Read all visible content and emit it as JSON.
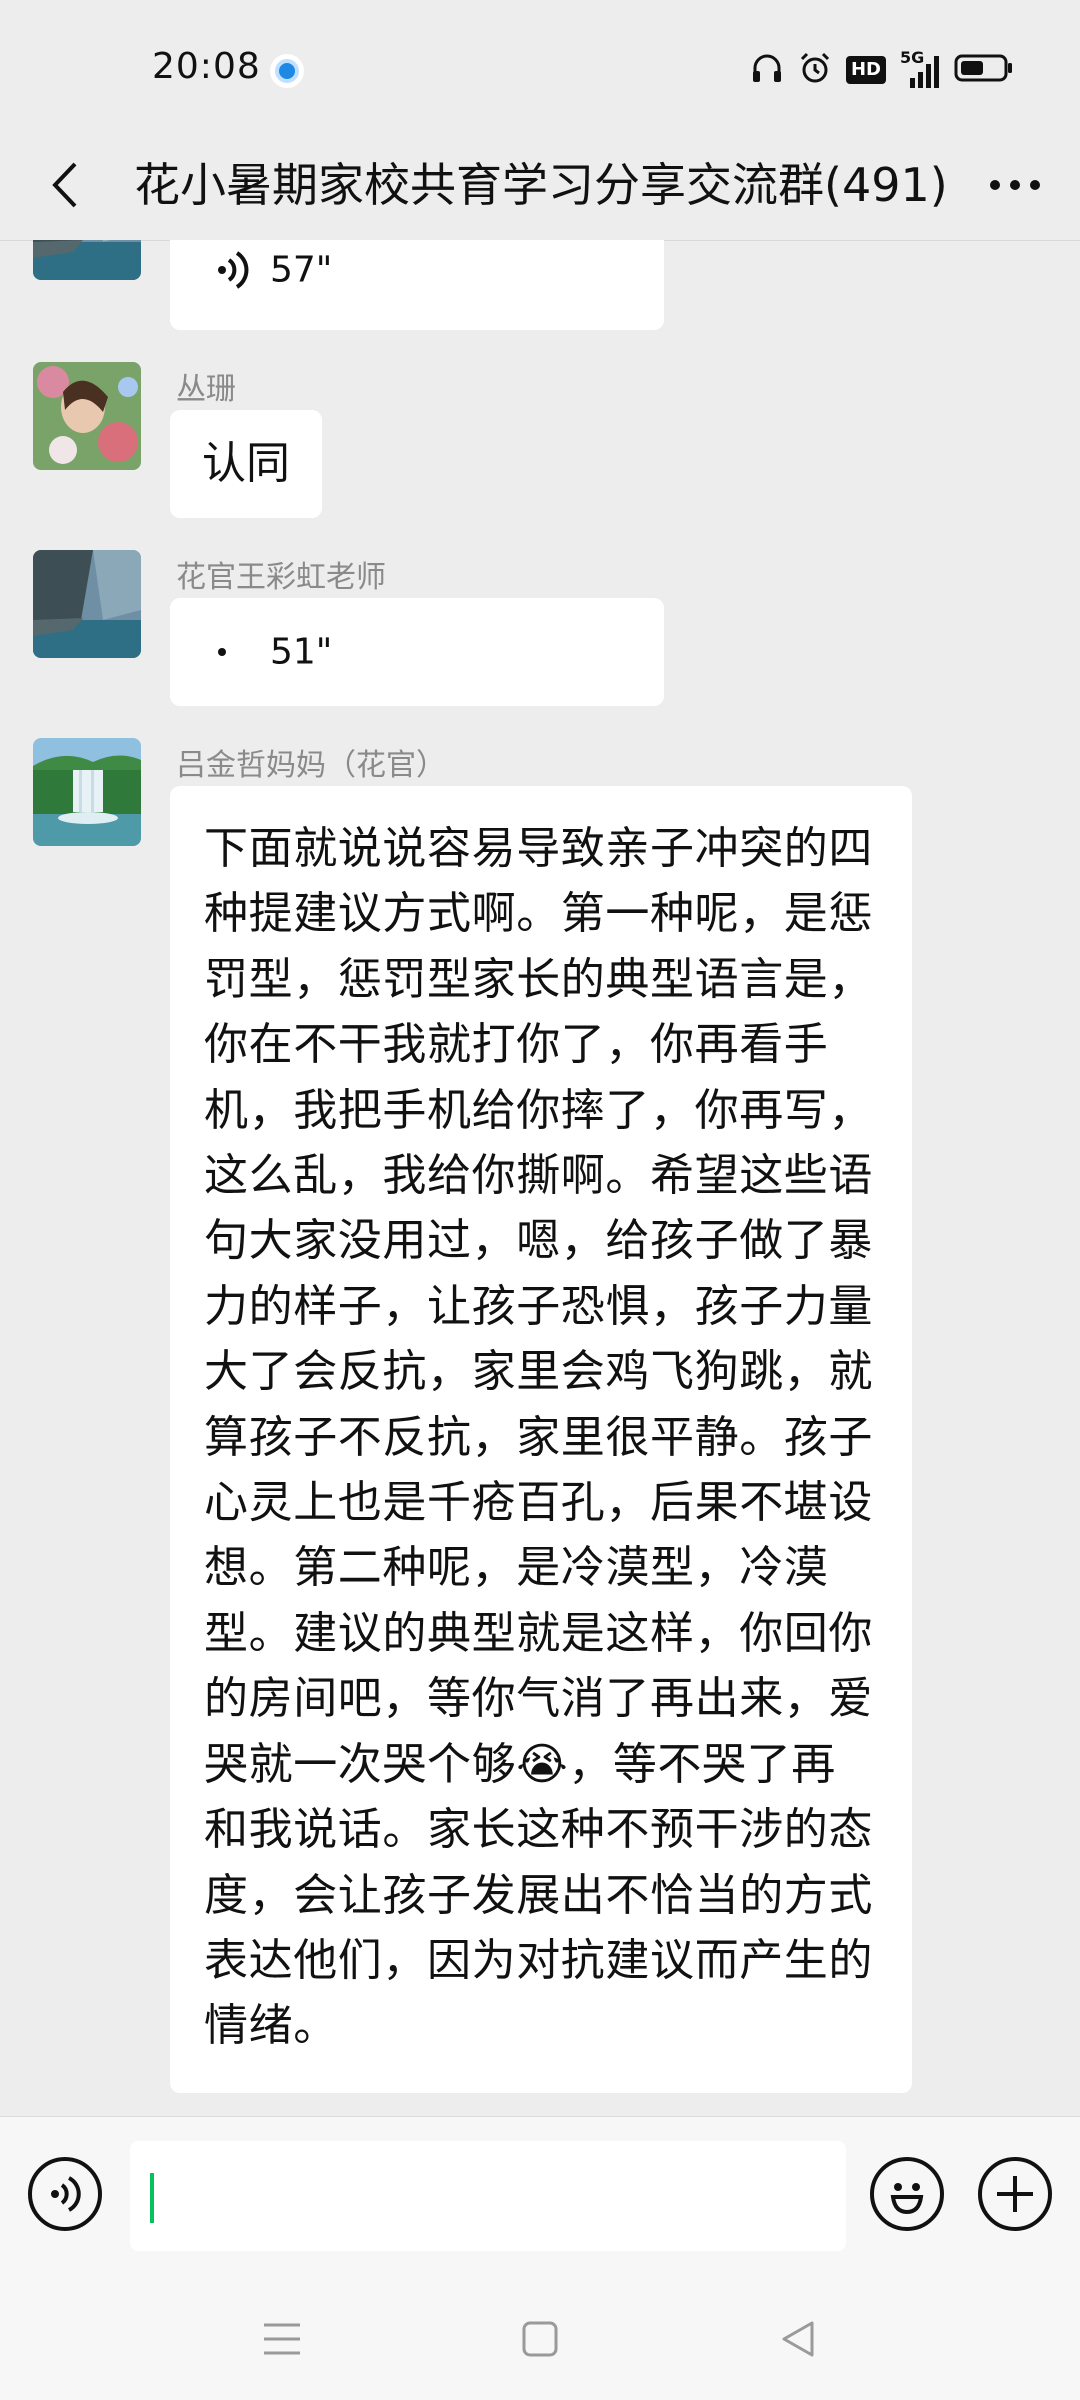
{
  "status_bar": {
    "time": "20:08",
    "hd_badge": "HD",
    "network": "5G",
    "icons": [
      "location-dot-icon",
      "headphones-icon",
      "alarm-icon",
      "hd-icon",
      "signal-icon",
      "battery-icon"
    ]
  },
  "header": {
    "title": "花小暑期家校共育学习分享交流群(491)",
    "back_icon": "chevron-left-icon",
    "more_icon": "more-dots-icon"
  },
  "messages": [
    {
      "type": "voice",
      "sender": "",
      "duration": "57\"",
      "avatar": "cliff-lake-avatar"
    },
    {
      "type": "text",
      "sender": "丛珊",
      "text": "认同",
      "avatar": "flowers-avatar"
    },
    {
      "type": "voice",
      "sender": "花官王彩虹老师",
      "duration": "51\"",
      "avatar": "cliff-lake-avatar"
    },
    {
      "type": "text",
      "sender": "吕金哲妈妈（花官）",
      "avatar": "waterfall-avatar",
      "text_before_emoji": "下面就说说容易导致亲子冲突的四种提建议方式啊。第一种呢，是惩罚型，惩罚型家长的典型语言是，你在不干我就打你了，你再看手机，我把手机给你摔了，你再写，这么乱，我给你撕啊。希望这些语句大家没用过，嗯，给孩子做了暴力的样子，让孩子恐惧，孩子力量大了会反抗，家里会鸡飞狗跳，就算孩子不反抗，家里很平静。孩子心灵上也是千疮百孔，后果不堪设想。第二种呢，是冷漠型，冷漠型。建议的典型就是这样，你回你的房间吧，等你气消了再出来，爱哭就一次哭个够",
      "emoji": "😭",
      "text_after_emoji": "，等不哭了再和我说话。家长这种不预干涉的态度，会让孩子发展出不恰当的方式表达他们，因为对抗建议而产生的情绪。"
    }
  ],
  "input_bar": {
    "voice_icon": "voice-input-icon",
    "emoji_icon": "emoji-icon",
    "plus_icon": "plus-icon"
  },
  "system_nav": {
    "icons": [
      "menu-icon",
      "home-icon",
      "back-triangle-icon"
    ]
  }
}
